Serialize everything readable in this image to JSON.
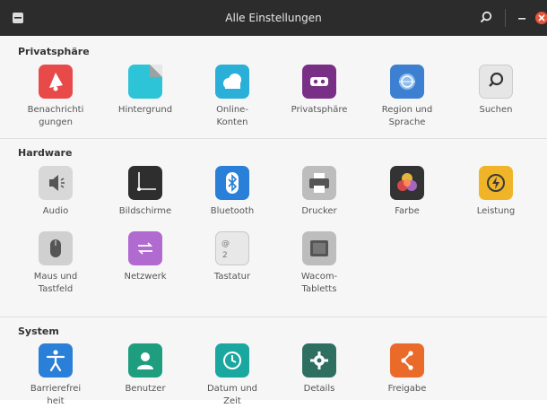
{
  "window": {
    "title": "Alle Einstellungen",
    "header_bg": "#2c2c2c"
  },
  "sections": {
    "privatsphaere": {
      "title": "Privatsphäre",
      "items": [
        {
          "label": "Benachrichti\ngungen",
          "icon": "bell-icon",
          "color": "#e84a4a"
        },
        {
          "label": "Hintergrund",
          "icon": "wallpaper-icon",
          "color": "#2ec4d8"
        },
        {
          "label": "Online-\nKonten",
          "icon": "cloud-icon",
          "color": "#2ab0d8"
        },
        {
          "label": "Privatsphäre",
          "icon": "mask-icon",
          "color": "#7a2f87"
        },
        {
          "label": "Region und\nSprache",
          "icon": "globe-icon",
          "color": "#3d7fd0"
        },
        {
          "label": "Suchen",
          "icon": "search-icon",
          "color": "#e6e6e6"
        }
      ]
    },
    "hardware": {
      "title": "Hardware",
      "items": [
        {
          "label": "Audio",
          "icon": "speaker-icon",
          "color": "#d8d8d8"
        },
        {
          "label": "Bildschirme",
          "icon": "display-icon",
          "color": "#2e2e2e"
        },
        {
          "label": "Bluetooth",
          "icon": "bluetooth-icon",
          "color": "#2a7fd8"
        },
        {
          "label": "Drucker",
          "icon": "printer-icon",
          "color": "#bdbdbd"
        },
        {
          "label": "Farbe",
          "icon": "color-icon",
          "color": "#333333"
        },
        {
          "label": "Leistung",
          "icon": "power-icon",
          "color": "#f0b429"
        },
        {
          "label": "Maus und\nTastfeld",
          "icon": "mouse-icon",
          "color": "#d0d0d0"
        },
        {
          "label": "Netzwerk",
          "icon": "network-icon",
          "color": "#b06ad0"
        },
        {
          "label": "Tastatur",
          "icon": "keyboard-icon",
          "color": "#e8e8e8"
        },
        {
          "label": "Wacom-\nTabletts",
          "icon": "tablet-icon",
          "color": "#bdbdbd"
        }
      ]
    },
    "system": {
      "title": "System",
      "items": [
        {
          "label": "Barrierefrei\nheit",
          "icon": "accessibility-icon",
          "color": "#2a7fd8"
        },
        {
          "label": "Benutzer",
          "icon": "user-icon",
          "color": "#1e9e7e"
        },
        {
          "label": "Datum und\nZeit",
          "icon": "clock-icon",
          "color": "#1aa7a0"
        },
        {
          "label": "Details",
          "icon": "gear-icon",
          "color": "#2f6f62"
        },
        {
          "label": "Freigabe",
          "icon": "share-icon",
          "color": "#ea6a2a"
        }
      ]
    }
  }
}
